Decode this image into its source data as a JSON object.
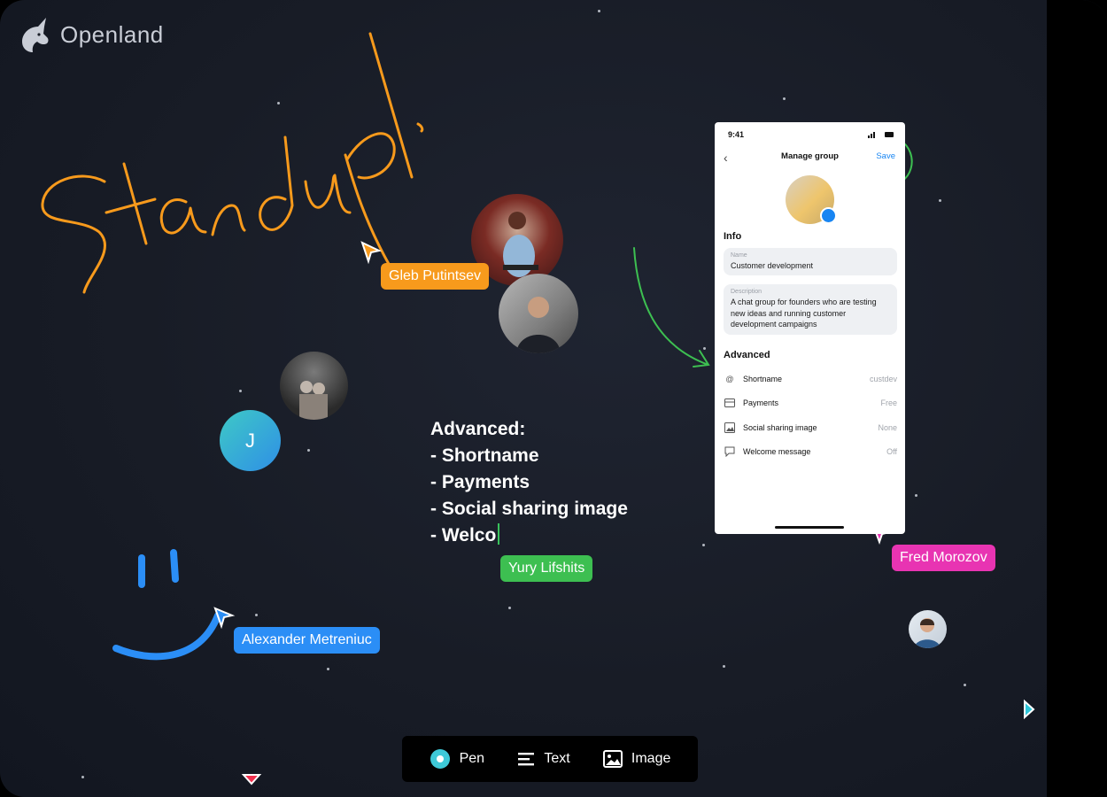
{
  "app": {
    "name": "Openland"
  },
  "whiteboard": {
    "handwriting": "Standup!",
    "note_lines": [
      "Advanced:",
      "- Shortname",
      "- Payments",
      "- Social sharing image",
      "- Welco"
    ]
  },
  "participants": {
    "gleb": "Gleb Putintsev",
    "yury": "Yury Lifshits",
    "fred": "Fred Morozov",
    "alexander": "Alexander Metreniuc",
    "initial_avatar": "J"
  },
  "phone": {
    "time": "9:41",
    "title": "Manage group",
    "save": "Save",
    "info_header": "Info",
    "name_label": "Name",
    "name_value": "Customer development",
    "desc_label": "Description",
    "desc_value": "A chat group for founders who are testing new ideas and running customer development campaigns",
    "advanced_header": "Advanced",
    "rows": [
      {
        "icon": "at-icon",
        "label": "Shortname",
        "value": "custdev"
      },
      {
        "icon": "card-icon",
        "label": "Payments",
        "value": "Free"
      },
      {
        "icon": "image-icon",
        "label": "Social sharing image",
        "value": "None"
      },
      {
        "icon": "chat-icon",
        "label": "Welcome message",
        "value": "Off"
      }
    ]
  },
  "toolbar": {
    "pen": "Pen",
    "text": "Text",
    "image": "Image"
  },
  "colors": {
    "accent_blue": "#2b8ef6",
    "orange": "#f79a1c",
    "green": "#3dbf51",
    "pink": "#e834b2",
    "end_call_red": "#f0304e"
  },
  "call_controls": [
    "collapse-icon",
    "end-call-icon",
    "mic-off-icon",
    "video-icon",
    "sparkle-icon",
    "chat-icon",
    "dice-icon",
    "settings-icon"
  ]
}
